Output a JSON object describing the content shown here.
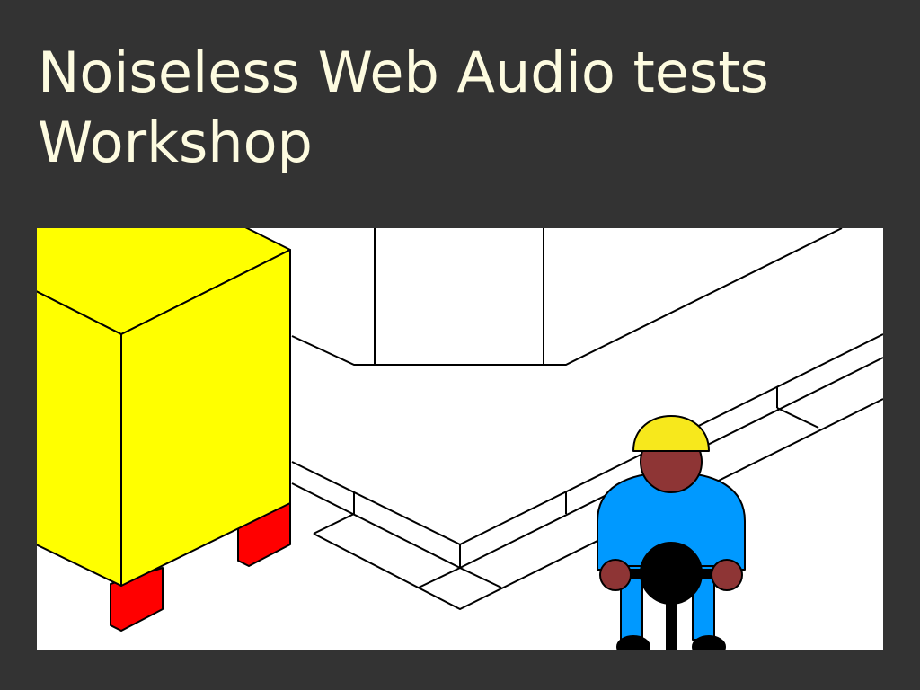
{
  "slide": {
    "title_line1": "Noiseless Web Audio tests",
    "title_line2": "Workshop"
  },
  "illustration": {
    "background": "#ffffff",
    "colors": {
      "crate": "#ffff00",
      "crate_legs": "#ff0000",
      "helmet": "#f7e81c",
      "skin": "#8e3535",
      "overalls": "#0099ff",
      "jackhammer": "#000000"
    },
    "figures": [
      "wall-outline",
      "road-curb",
      "yellow-crate",
      "construction-worker",
      "jackhammer"
    ]
  }
}
